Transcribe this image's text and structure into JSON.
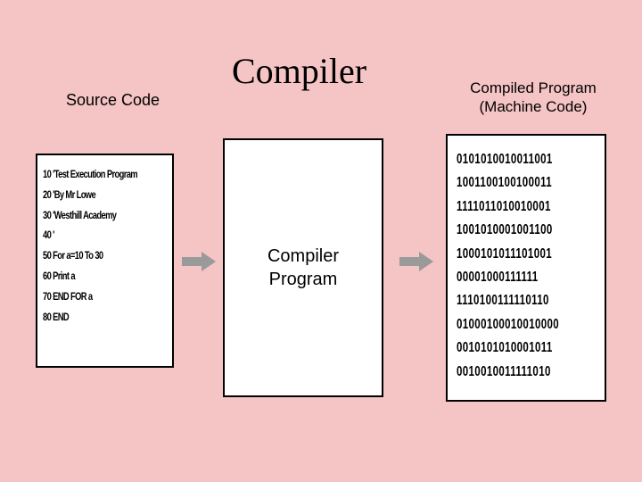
{
  "title": "Compiler",
  "labels": {
    "source": "Source Code",
    "compiled_line1": "Compiled Program",
    "compiled_line2": "(Machine Code)"
  },
  "compiler_box": {
    "line1": "Compiler",
    "line2": "Program"
  },
  "source_code": [
    "10 'Test Execution Program",
    "20 'By Mr Lowe",
    "30 'Westhill Academy",
    "40 '",
    "50 For a=10 To 30",
    "60  Print a",
    "70 END FOR a",
    "80 END"
  ],
  "machine_code": [
    "0101010010011001",
    "1001100100100011",
    "1111011010010001",
    "1001010001001100",
    "1000101011101001",
    "00001000111111",
    "1110100111110110",
    "01000100010010000",
    "0010101010001011",
    "0010010011111010"
  ]
}
